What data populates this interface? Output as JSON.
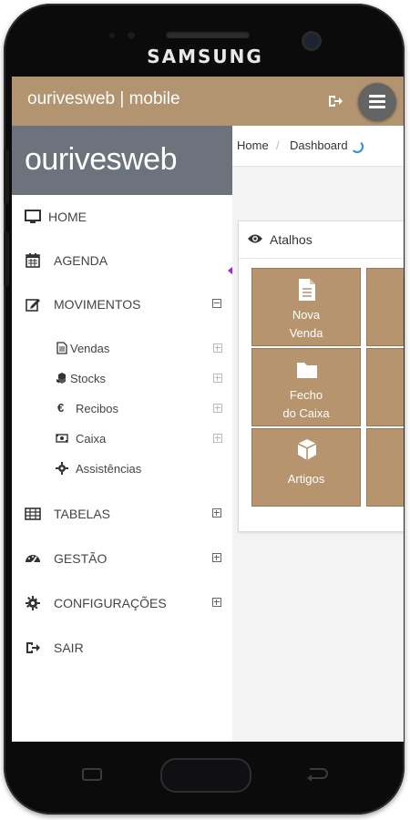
{
  "device": {
    "brand": "SAMSUNG"
  },
  "app": {
    "title": "ourivesweb | mobile"
  },
  "sidebar": {
    "logo": "ourivesweb",
    "items": [
      {
        "label": "HOME",
        "icon": "monitor-icon",
        "expander": ""
      },
      {
        "label": "AGENDA",
        "icon": "calendar-icon",
        "expander": ""
      },
      {
        "label": "MOVIMENTOS",
        "icon": "edit-icon",
        "expander": "minus"
      },
      {
        "label": "TABELAS",
        "icon": "table-icon",
        "expander": "plus"
      },
      {
        "label": "GESTÃO",
        "icon": "dashboard-icon",
        "expander": "plus"
      },
      {
        "label": "CONFIGURAÇÕES",
        "icon": "gear-icon",
        "expander": "plus"
      },
      {
        "label": "SAIR",
        "icon": "sign-out-icon",
        "expander": ""
      }
    ],
    "subitems": [
      {
        "label": "Vendas",
        "icon": "document-icon"
      },
      {
        "label": "Stocks",
        "icon": "cubes-icon"
      },
      {
        "label": "Recibos",
        "icon": "euro-icon"
      },
      {
        "label": "Caixa",
        "icon": "money-icon"
      },
      {
        "label": "Assistências",
        "icon": "cog-icon"
      }
    ]
  },
  "breadcrumb": {
    "home": "Home",
    "separator": "/",
    "current": "Dashboard"
  },
  "shortcuts": {
    "title": "Atalhos",
    "tiles": [
      {
        "line1": "Nova",
        "line2": "Venda",
        "icon": "document-icon"
      },
      {
        "line1": "Fecho",
        "line2": "do Caixa",
        "icon": "folder-icon"
      },
      {
        "line1": "Artigos",
        "line2": "",
        "icon": "cube-icon"
      }
    ]
  },
  "colors": {
    "accent": "#b29470",
    "tile": "#b6946e",
    "logo_bg": "#6d737c",
    "menu_button": "#646464"
  }
}
